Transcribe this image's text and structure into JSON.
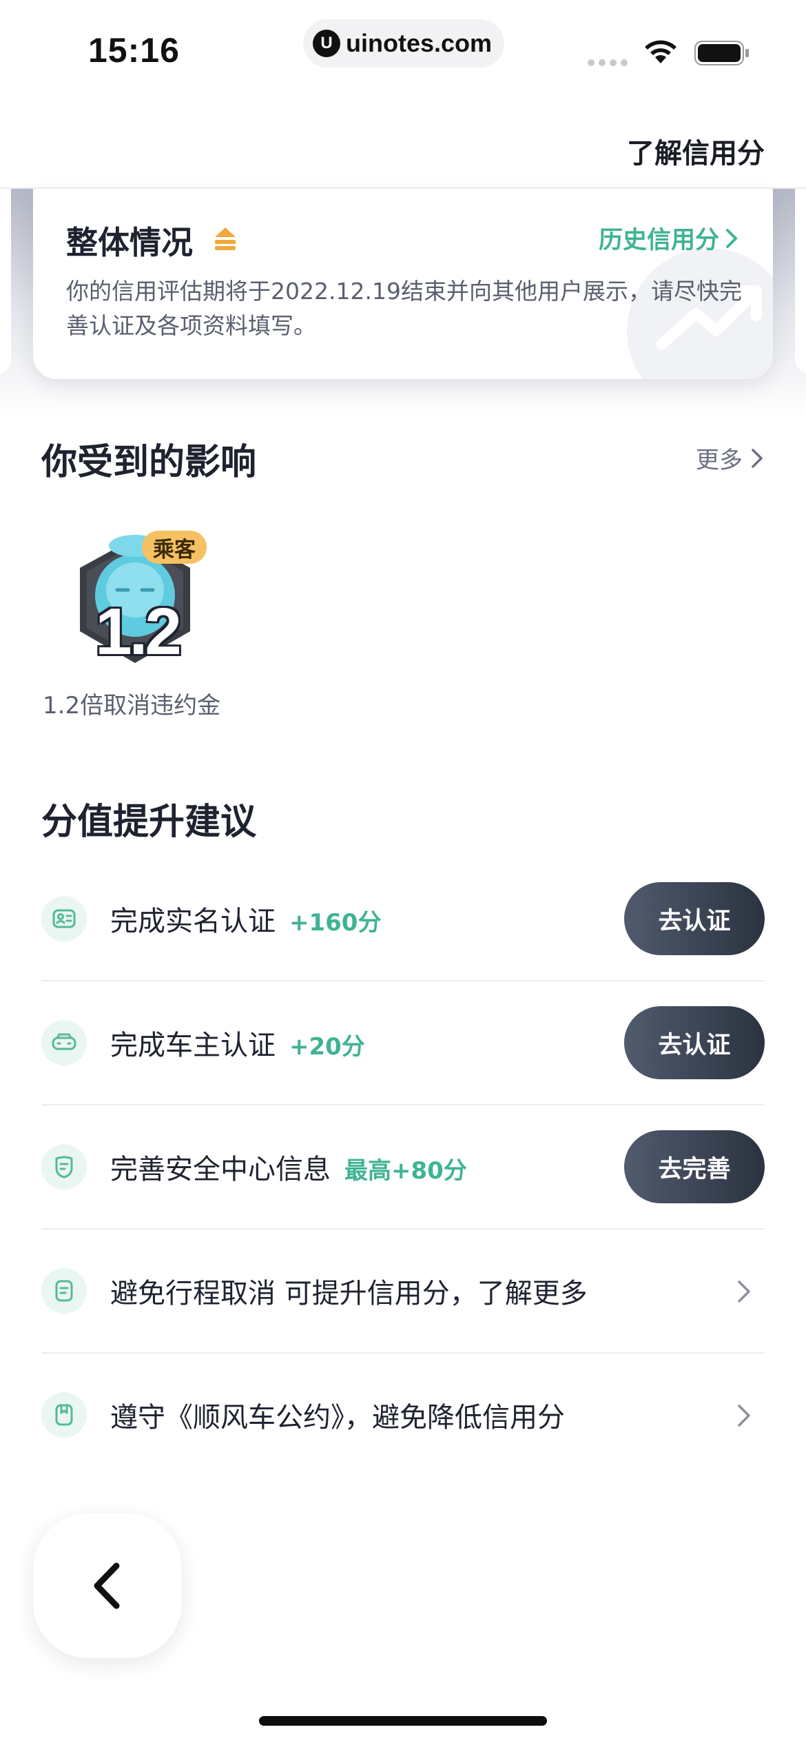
{
  "status_bar": {
    "time": "15:16",
    "url": "uinotes.com",
    "url_logo": "U"
  },
  "header": {
    "learn_link": "了解信用分"
  },
  "overview": {
    "title": "整体情况",
    "history_link": "历史信用分",
    "description": "你的信用评估期将于2022.12.19结束并向其他用户展示，请尽快完善认证及各项资料填写。",
    "accent_color": "#3fb393",
    "trend_color": "#f0a93a"
  },
  "impact": {
    "title": "你受到的影响",
    "more_label": "更多",
    "badge": {
      "tag": "乘客",
      "value": "1.2",
      "caption": "1.2倍取消违约金"
    }
  },
  "suggestions": {
    "title": "分值提升建议",
    "items": [
      {
        "icon": "id-card-icon",
        "label": "完成实名认证",
        "points": "+160分",
        "action": "去认证"
      },
      {
        "icon": "car-icon",
        "label": "完成车主认证",
        "points": "+20分",
        "action": "去认证"
      },
      {
        "icon": "shield-icon",
        "label": "完善安全中心信息",
        "points": "最高+80分",
        "action": "去完善"
      },
      {
        "icon": "document-icon",
        "label": "避免行程取消 可提升信用分，了解更多",
        "points": "",
        "action": ""
      },
      {
        "icon": "bookmark-icon",
        "label": "遵守《顺风车公约》，避免降低信用分",
        "points": "",
        "action": ""
      }
    ]
  }
}
